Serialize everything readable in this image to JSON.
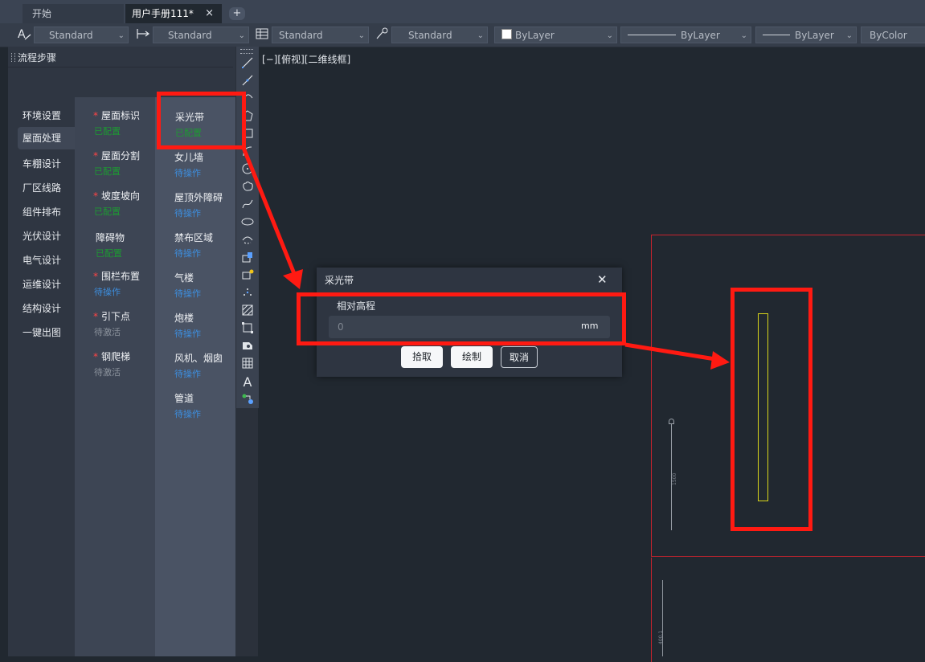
{
  "tabs": [
    {
      "label": "开始",
      "active": false
    },
    {
      "label": "用户手册111*",
      "active": true
    }
  ],
  "tab_close_icon": "×",
  "new_tab_label": "+",
  "properties": {
    "text_style": "Standard",
    "dim_style": "Standard",
    "table_style": "Standard",
    "multileader_style": "Standard",
    "color": "ByLayer",
    "linetype": "ByLayer",
    "lineweight": "ByLayer",
    "plot_style": "ByColor"
  },
  "panel": {
    "title": "流程步骤",
    "stages": [
      "环境设置",
      "屋面处理",
      "车棚设计",
      "厂区线路",
      "组件排布",
      "光伏设计",
      "电气设计",
      "运维设计",
      "结构设计",
      "一键出图"
    ],
    "selected_stage": "屋面处理",
    "column1": [
      {
        "name": "屋面标识",
        "required": true,
        "status": "已配置"
      },
      {
        "name": "屋面分割",
        "required": true,
        "status": "已配置"
      },
      {
        "name": "坡度坡向",
        "required": true,
        "status": "已配置"
      },
      {
        "name": "障碍物",
        "required": false,
        "status": "已配置"
      },
      {
        "name": "围栏布置",
        "required": true,
        "status": "待操作"
      },
      {
        "name": "引下点",
        "required": true,
        "status": "待激活"
      },
      {
        "name": "钢爬梯",
        "required": true,
        "status": "待激活"
      }
    ],
    "column2": [
      {
        "name": "采光带",
        "status": "已配置"
      },
      {
        "name": "女儿墙",
        "status": "待操作"
      },
      {
        "name": "屋顶外障碍",
        "status": "待操作"
      },
      {
        "name": "禁布区域",
        "status": "待操作"
      },
      {
        "name": "气楼",
        "status": "待操作"
      },
      {
        "name": "炮楼",
        "status": "待操作"
      },
      {
        "name": "风机、烟囱",
        "status": "待操作"
      },
      {
        "name": "管道",
        "status": "待操作"
      }
    ]
  },
  "viewport": {
    "label": "[−][俯视][二维线框]"
  },
  "cad": {
    "dim_text_1": "1500",
    "dim_text_2": "400.1"
  },
  "dialog": {
    "title": "采光带",
    "field_label": "相对高程",
    "field_placeholder": "0",
    "field_unit": "mm",
    "buttons": {
      "pick": "拾取",
      "draw": "绘制",
      "cancel": "取消"
    },
    "close_icon": "✕"
  },
  "colors": {
    "status_done": "#1d9a32",
    "status_pending": "#3d8fe0",
    "status_inactive": "#8c939d",
    "annotation_red": "#ff1a12",
    "drawing_border": "#c8232d",
    "skylight_yellow": "#d9d51a"
  }
}
